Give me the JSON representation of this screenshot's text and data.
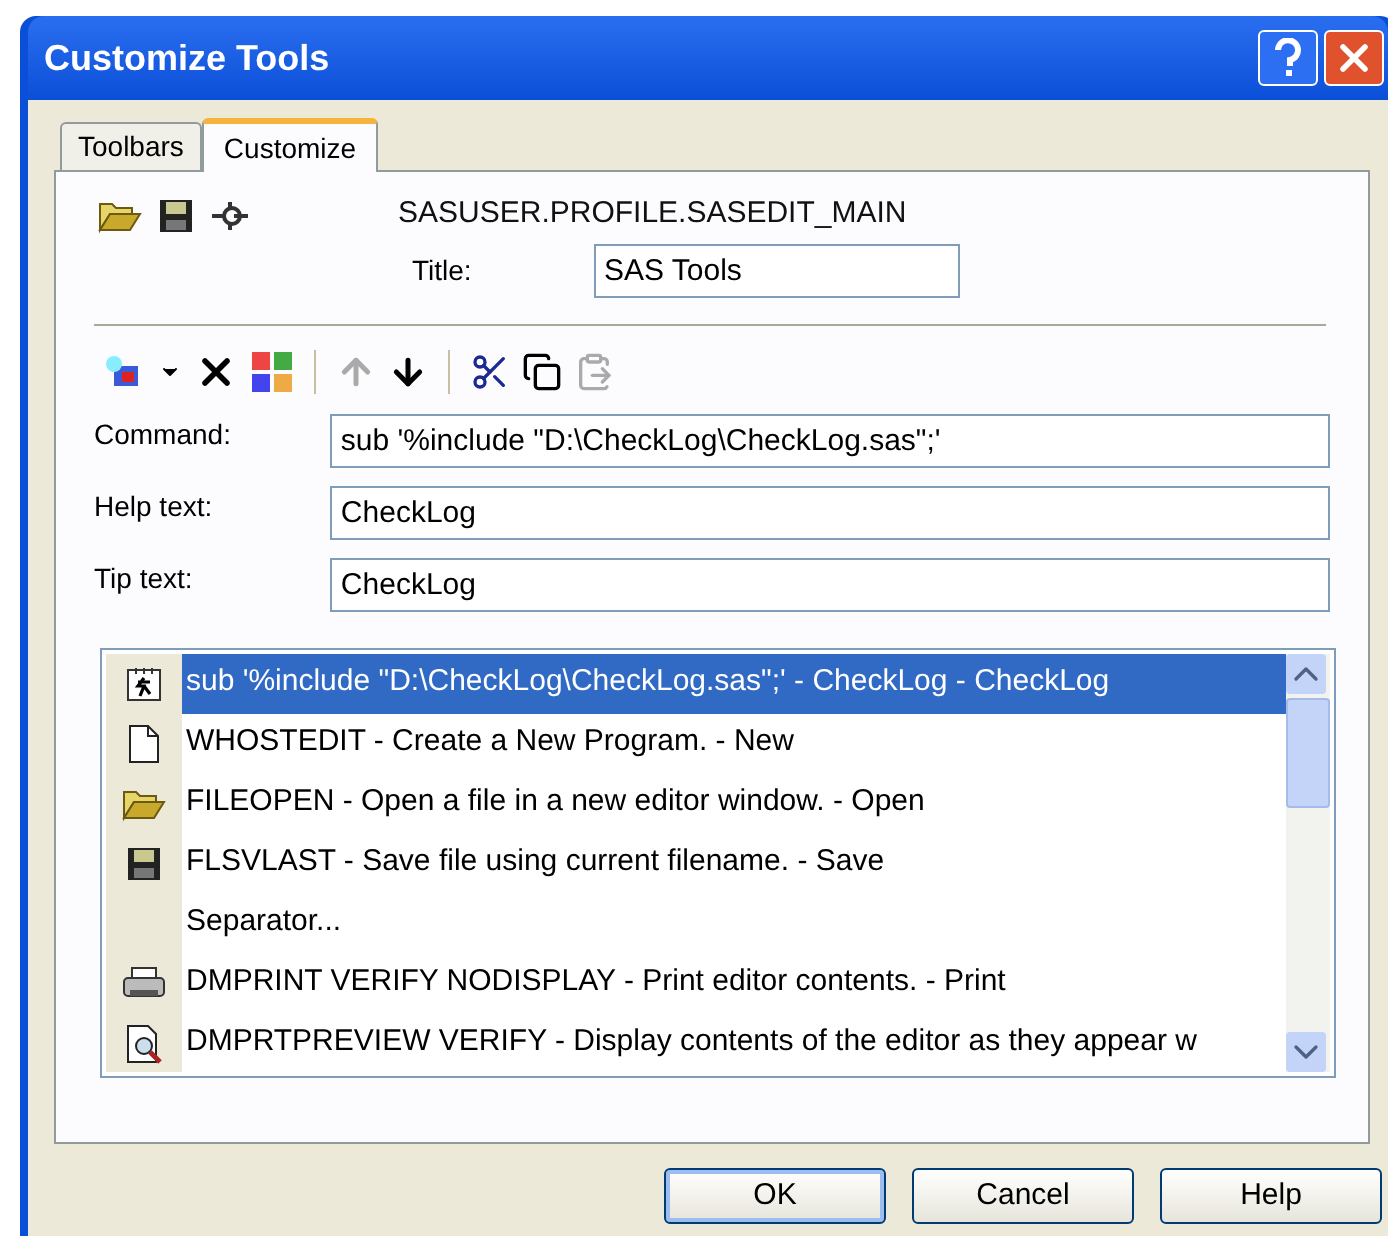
{
  "window": {
    "title": "Customize Tools"
  },
  "tabs": [
    {
      "label": "Toolbars",
      "selected": false
    },
    {
      "label": "Customize",
      "selected": true
    }
  ],
  "toolbar_name": "SASUSER.PROFILE.SASEDIT_MAIN",
  "title_field": {
    "label": "Title:",
    "value": "SAS Tools"
  },
  "fields": [
    {
      "label": "Command:",
      "value": "sub '%include \"D:\\CheckLog\\CheckLog.sas\";'"
    },
    {
      "label": "Help text:",
      "value": "CheckLog"
    },
    {
      "label": "Tip text:",
      "value": "CheckLog"
    }
  ],
  "tools": [
    {
      "kind": "run",
      "text": "sub '%include \"D:\\CheckLog\\CheckLog.sas\";'  - CheckLog - CheckLog",
      "selected": true
    },
    {
      "kind": "new",
      "text": "WHOSTEDIT - Create a New Program. - New",
      "selected": false
    },
    {
      "kind": "open",
      "text": "FILEOPEN - Open a file in a new editor window. - Open",
      "selected": false
    },
    {
      "kind": "save",
      "text": "FLSVLAST - Save file using current filename. - Save",
      "selected": false
    },
    {
      "kind": "separator",
      "text": "Separator...",
      "selected": false
    },
    {
      "kind": "print",
      "text": "DMPRINT VERIFY NODISPLAY - Print editor contents. - Print",
      "selected": false
    },
    {
      "kind": "preview",
      "text": "DMPRTPREVIEW VERIFY - Display contents of the editor as they appear w",
      "selected": false
    }
  ],
  "buttons": [
    "OK",
    "Cancel",
    "Help"
  ]
}
